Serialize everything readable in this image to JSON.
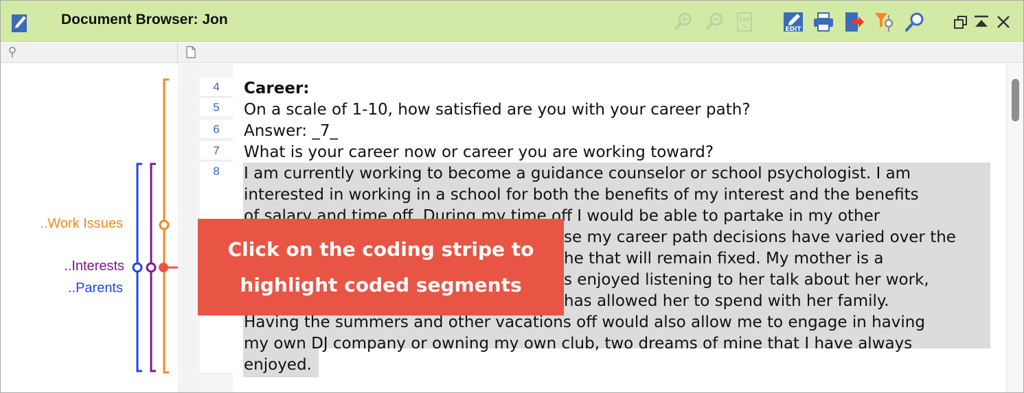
{
  "window": {
    "title": "Document Browser: Jon"
  },
  "toolbar": {
    "icons": [
      "zoom-in-icon",
      "zoom-out-icon",
      "percent-view-icon",
      "edit-icon",
      "print-icon",
      "export-icon",
      "filter-codes-icon",
      "search-icon",
      "restore-window-icon",
      "collapse-icon",
      "close-icon"
    ],
    "edit_label": "EDIT"
  },
  "codes": {
    "work_issues": {
      "label": "..Work Issues",
      "color": "#f28a1e"
    },
    "interests": {
      "label": "..Interests",
      "color": "#7a1a8c"
    },
    "parents": {
      "label": "..Parents",
      "color": "#2346e8"
    }
  },
  "document": {
    "line_numbers": [
      "4",
      "5",
      "6",
      "7",
      "8"
    ],
    "lines": [
      "Career:",
      "On a scale of 1-10, how satisfied are you with your career path?",
      "Answer: _7_",
      "What is your career now or career you are working toward?",
      "I am currently working to become a guidance counselor or school psychologist.  I am",
      "interested in working in a school for both the benefits of my interest and the benefits",
      "of salary and time off.  During my time off I would be able to partake in my other",
      "se my career path decisions have varied over the",
      "he that will remain fixed.  My mother is a",
      "s enjoyed listening to her talk about her work,",
      "has allowed her to spend with her family.",
      "Having the summers and other vacations off would also allow me to engage in having",
      "my own DJ company or owning my own club, two dreams of mine that I have always",
      "enjoyed."
    ]
  },
  "callout": {
    "text": "Click on the coding stripe to highlight coded segments",
    "color": "#e85544"
  }
}
